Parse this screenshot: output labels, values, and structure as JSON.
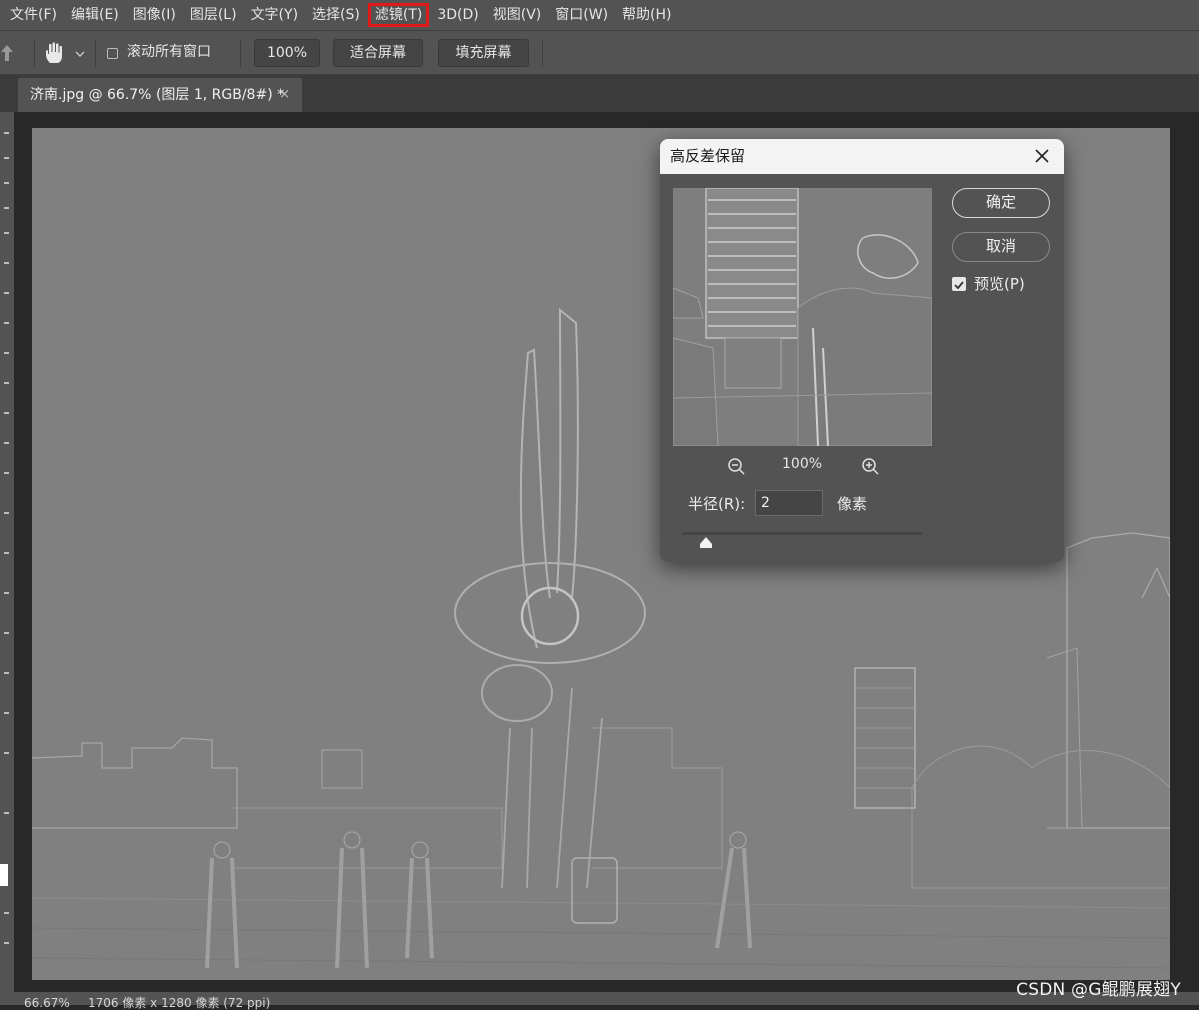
{
  "menu": [
    "文件(F)",
    "编辑(E)",
    "图像(I)",
    "图层(L)",
    "文字(Y)",
    "选择(S)",
    "滤镜(T)",
    "3D(D)",
    "视图(V)",
    "窗口(W)",
    "帮助(H)"
  ],
  "menu_highlight_color": "#e0191b",
  "options": {
    "scroll_all_label": "滚动所有窗口",
    "zoom_label": "100%",
    "fit_screen_label": "适合屏幕",
    "fill_screen_label": "填充屏幕"
  },
  "document_tab": {
    "title": "济南.jpg @ 66.7% (图层 1, RGB/8#) *",
    "close_glyph": "×"
  },
  "dialog": {
    "title": "高反差保留",
    "ok_label": "确定",
    "cancel_label": "取消",
    "preview_label": "预览(P)",
    "preview_checked": true,
    "zoom_level": "100%",
    "radius_label": "半径(R):",
    "radius_value": "2",
    "radius_unit": "像素"
  },
  "status": {
    "zoom": "66.67%",
    "dimensions": "1706 像素 x 1280 像素 (72 ppi)"
  },
  "watermark": "CSDN @G鲲鹏展翅Y"
}
